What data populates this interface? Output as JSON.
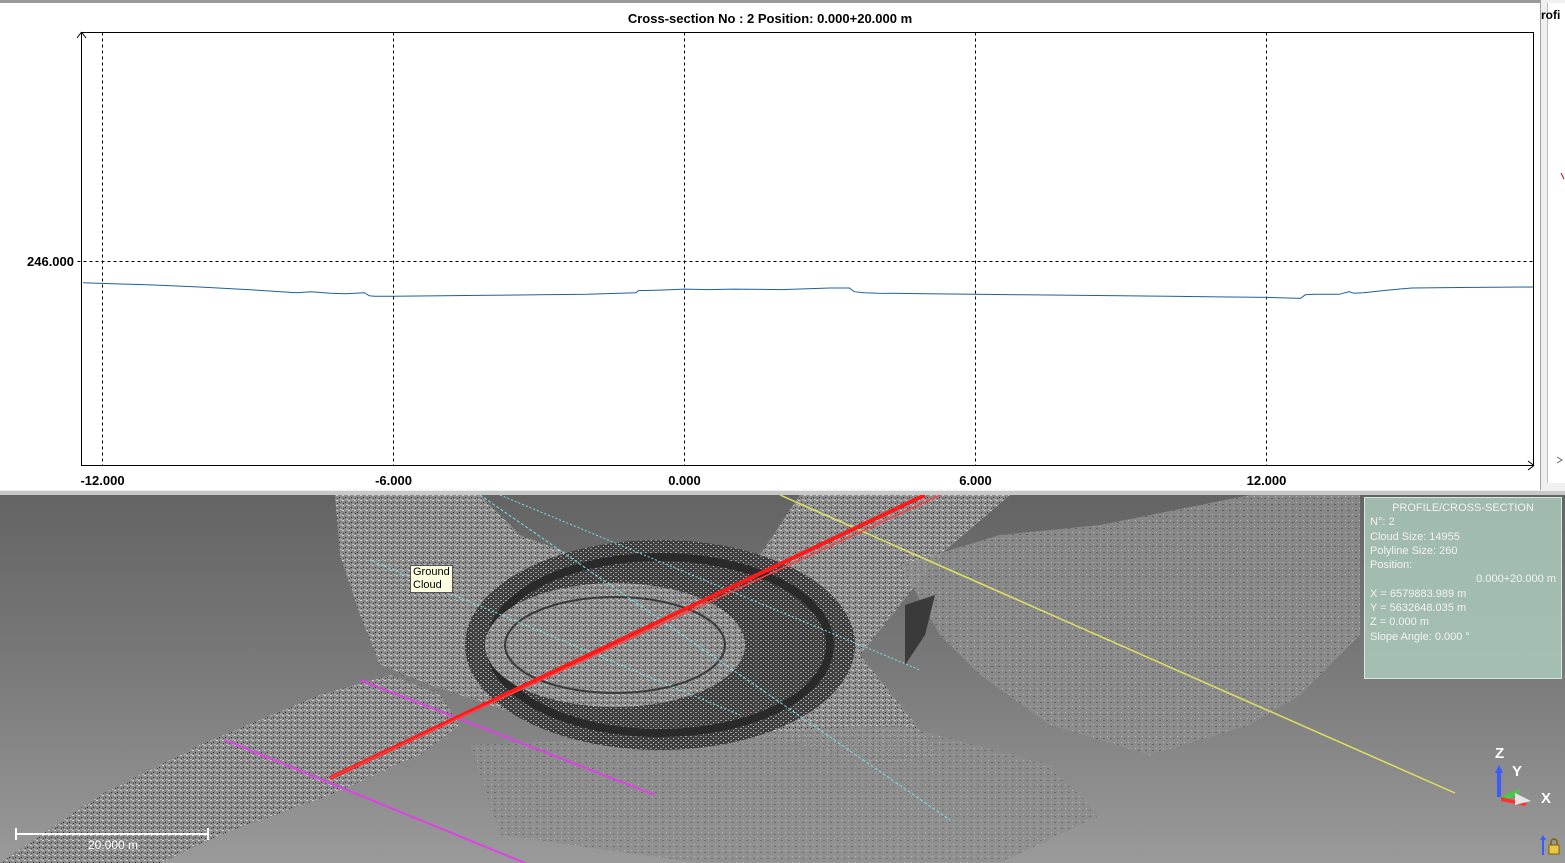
{
  "profile": {
    "title": "Cross-section No : 2   Position: 0.000+20.000 m",
    "side_label": "rofi",
    "y_tick": "246.000",
    "x_ticks": [
      "-12.000",
      "-6.000",
      "0.000",
      "6.000",
      "12.000"
    ]
  },
  "chart_data": {
    "type": "line",
    "title": "Cross-section No : 2   Position: 0.000+20.000 m",
    "xlabel": "",
    "ylabel": "",
    "x_ticks": [
      -12,
      -6,
      0,
      6,
      12
    ],
    "y_ticks": [
      246
    ],
    "xlim": [
      -12.4,
      17.5
    ],
    "grid": true,
    "series": [
      {
        "color": "#1f5f9e",
        "x": [
          -12.4,
          -11.0,
          -10.0,
          -9.0,
          -8.0,
          -7.7,
          -7.3,
          -7.0,
          -6.6,
          -6.5,
          -6.4,
          -6.0,
          -5.0,
          -4.0,
          -3.0,
          -2.0,
          -1.0,
          -0.95,
          -0.5,
          0.0,
          0.5,
          1.0,
          2.0,
          3.0,
          3.4,
          3.5,
          3.7,
          4.0,
          5.0,
          6.0,
          7.0,
          8.0,
          9.0,
          10.0,
          11.0,
          12.0,
          12.7,
          12.8,
          13.0,
          13.5,
          13.7,
          13.8,
          14.0,
          14.5,
          15.0,
          16.0,
          17.5
        ],
        "y": [
          245.59,
          245.55,
          245.51,
          245.46,
          245.4,
          245.42,
          245.39,
          245.38,
          245.4,
          245.34,
          245.33,
          245.33,
          245.34,
          245.35,
          245.36,
          245.37,
          245.4,
          245.44,
          245.45,
          245.47,
          245.46,
          245.47,
          245.46,
          245.49,
          245.49,
          245.42,
          245.4,
          245.39,
          245.38,
          245.37,
          245.36,
          245.35,
          245.34,
          245.33,
          245.32,
          245.31,
          245.29,
          245.36,
          245.37,
          245.37,
          245.42,
          245.39,
          245.4,
          245.45,
          245.49,
          245.5,
          245.51
        ]
      }
    ]
  },
  "view3d": {
    "tooltip_lines": [
      "Ground",
      "Cloud"
    ],
    "info_panel": {
      "header": "PROFILE/CROSS-SECTION",
      "number": "N°: 2",
      "cloud_size": "Cloud Size: 14955",
      "polyline_size": "Polyline Size: 260",
      "position_label": "Position:",
      "position_value": "0.000+20.000 m",
      "x": "X = 6579883.989 m",
      "y": "Y = 5632648.035 m",
      "z": "Z = 0.000 m",
      "slope": "Slope Angle: 0.000 °"
    },
    "scale_label": "20.000 m",
    "axis": {
      "z": "Z",
      "y": "Y",
      "x": "X"
    },
    "colors": {
      "polyline": "#ff1a1a",
      "cyan_line": "#78e0e8",
      "magenta_line": "#e040e8",
      "yellow_line": "#e0e060",
      "info_bg": "#afcdbe"
    }
  }
}
